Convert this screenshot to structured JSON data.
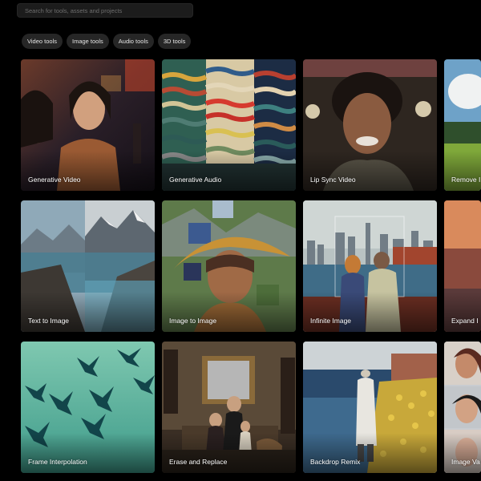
{
  "search": {
    "placeholder": "Search for tools, assets and projects"
  },
  "filters": [
    {
      "label": "Video tools"
    },
    {
      "label": "Image tools"
    },
    {
      "label": "Audio tools"
    },
    {
      "label": "3D tools"
    }
  ],
  "tools": [
    {
      "label": "Generative Video"
    },
    {
      "label": "Generative Audio"
    },
    {
      "label": "Lip Sync Video"
    },
    {
      "label": "Remove I"
    },
    {
      "label": "Text to Image"
    },
    {
      "label": "Image to Image"
    },
    {
      "label": "Infinite Image"
    },
    {
      "label": "Expand I"
    },
    {
      "label": "Frame Interpolation"
    },
    {
      "label": "Erase and Replace"
    },
    {
      "label": "Backdrop Remix"
    },
    {
      "label": "Image Va"
    }
  ]
}
